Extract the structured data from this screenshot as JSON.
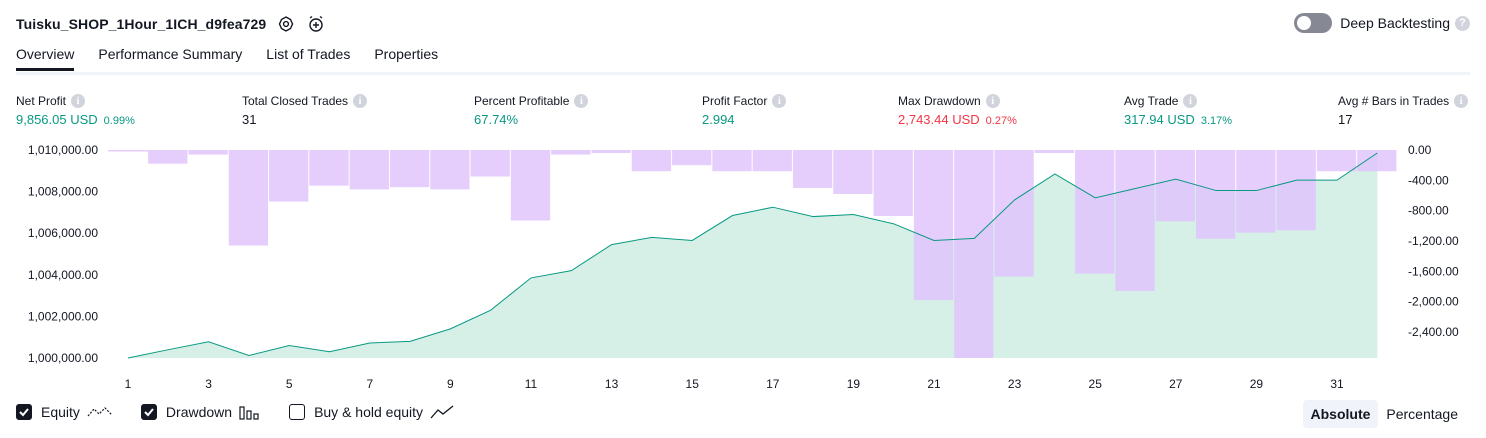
{
  "header": {
    "title": "Tuisku_SHOP_1Hour_1ICH_d9fea729",
    "deep_label": "Deep Backtesting"
  },
  "tabs": [
    "Overview",
    "Performance Summary",
    "List of Trades",
    "Properties"
  ],
  "metrics": [
    {
      "label": "Net Profit",
      "value": "9,856.05 USD",
      "pct": "0.99%",
      "color": "green"
    },
    {
      "label": "Total Closed Trades",
      "value": "31",
      "pct": "",
      "color": "dark"
    },
    {
      "label": "Percent Profitable",
      "value": "67.74%",
      "pct": "",
      "color": "green"
    },
    {
      "label": "Profit Factor",
      "value": "2.994",
      "pct": "",
      "color": "green"
    },
    {
      "label": "Max Drawdown",
      "value": "2,743.44 USD",
      "pct": "0.27%",
      "color": "red"
    },
    {
      "label": "Avg Trade",
      "value": "317.94 USD",
      "pct": "3.17%",
      "color": "green"
    },
    {
      "label": "Avg # Bars in Trades",
      "value": "17",
      "pct": "",
      "color": "dark"
    }
  ],
  "legend": {
    "equity": "Equity",
    "drawdown": "Drawdown",
    "buyhold": "Buy & hold equity"
  },
  "modes": {
    "absolute": "Absolute",
    "percentage": "Percentage"
  },
  "colors": {
    "equity_line": "#089981",
    "equity_fill": "#d6f0e8",
    "drawdown_fill": "#e1c4fc"
  },
  "chart_data": {
    "type": "area",
    "x_ticks": [
      1,
      3,
      5,
      7,
      9,
      11,
      13,
      15,
      17,
      19,
      21,
      23,
      25,
      27,
      29,
      31
    ],
    "left_axis": {
      "ticks": [
        "1,010,000.00",
        "1,008,000.00",
        "1,006,000.00",
        "1,004,000.00",
        "1,002,000.00",
        "1,000,000.00"
      ],
      "range": [
        1000000,
        1010000
      ]
    },
    "right_axis": {
      "ticks": [
        "0.00",
        "-400.00",
        "-800.00",
        "-1,200.00",
        "-1,600.00",
        "-2,000.00",
        "-2,400.00"
      ],
      "range": [
        -2743.44,
        0
      ]
    },
    "series": [
      {
        "name": "Equity",
        "x": [
          1,
          2,
          3,
          4,
          5,
          6,
          7,
          8,
          9,
          10,
          11,
          12,
          13,
          14,
          15,
          16,
          17,
          18,
          19,
          20,
          21,
          22,
          23,
          24,
          25,
          26,
          27,
          28,
          29,
          30,
          31,
          32
        ],
        "values": [
          1000000,
          1000400,
          1000780,
          1000120,
          1000600,
          1000300,
          1000720,
          1000800,
          1001400,
          1002300,
          1003850,
          1004200,
          1005450,
          1005800,
          1005650,
          1006850,
          1007250,
          1006800,
          1006900,
          1006450,
          1005650,
          1005750,
          1007600,
          1008850,
          1007700,
          1008150,
          1008600,
          1008050,
          1008050,
          1008550,
          1008550,
          1009856
        ]
      },
      {
        "name": "Drawdown",
        "x": [
          1,
          2,
          3,
          4,
          5,
          6,
          7,
          8,
          9,
          10,
          11,
          12,
          13,
          14,
          15,
          16,
          17,
          18,
          19,
          20,
          21,
          22,
          23,
          24,
          25,
          26,
          27,
          28,
          29,
          30,
          31,
          32
        ],
        "values": [
          -15,
          -180,
          -60,
          -1260,
          -680,
          -470,
          -520,
          -490,
          -520,
          -350,
          -930,
          -60,
          -40,
          -280,
          -200,
          -280,
          -280,
          -500,
          -580,
          -870,
          -1980,
          -2743.44,
          -1670,
          -40,
          -1630,
          -1860,
          -940,
          -1170,
          -1090,
          -1060,
          -280,
          -280
        ]
      }
    ]
  }
}
